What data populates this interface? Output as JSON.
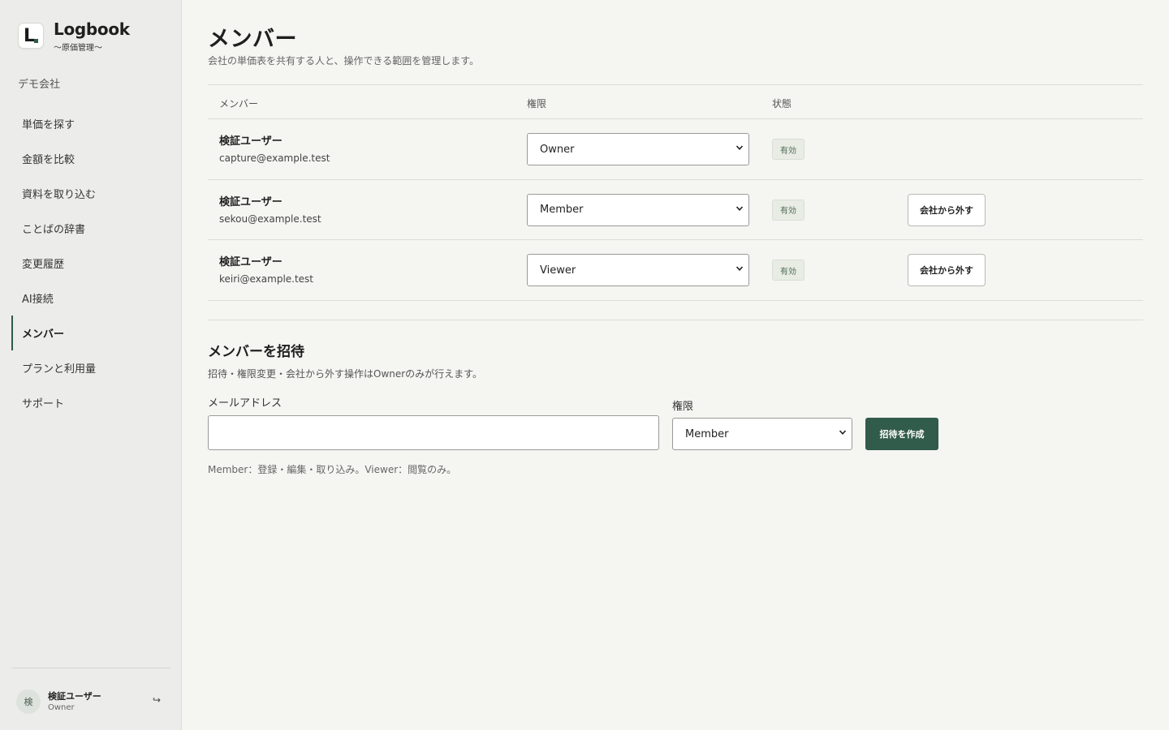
{
  "brand": {
    "name": "Logbook",
    "subtitle": "〜原価管理〜",
    "logo_letter": "L"
  },
  "company": "デモ会社",
  "nav": [
    {
      "label": "単価を探す",
      "active": false
    },
    {
      "label": "金額を比較",
      "active": false
    },
    {
      "label": "資料を取り込む",
      "active": false
    },
    {
      "label": "ことばの辞書",
      "active": false
    },
    {
      "label": "変更履歴",
      "active": false
    },
    {
      "label": "AI接続",
      "active": false
    },
    {
      "label": "メンバー",
      "active": true
    },
    {
      "label": "プランと利用量",
      "active": false
    },
    {
      "label": "サポート",
      "active": false
    }
  ],
  "user": {
    "avatar_letter": "検",
    "name": "検証ユーザー",
    "role": "Owner",
    "logout_icon": "↪"
  },
  "page": {
    "title": "メンバー",
    "description": "会社の単価表を共有する人と、操作できる範囲を管理します。"
  },
  "table": {
    "headers": {
      "member": "メンバー",
      "role": "権限",
      "status": "状態"
    },
    "rows": [
      {
        "name": "検証ユーザー",
        "email": "capture@example.test",
        "role": "Owner",
        "status": "有効",
        "remove_label": ""
      },
      {
        "name": "検証ユーザー",
        "email": "sekou@example.test",
        "role": "Member",
        "status": "有効",
        "remove_label": "会社から外す"
      },
      {
        "name": "検証ユーザー",
        "email": "keiri@example.test",
        "role": "Viewer",
        "status": "有効",
        "remove_label": "会社から外す"
      }
    ]
  },
  "invite": {
    "title": "メンバーを招待",
    "description": "招待・権限変更・会社から外す操作はOwnerのみが行えます。",
    "email_label": "メールアドレス",
    "email_value": "",
    "role_label": "権限",
    "role_value": "Member",
    "submit_label": "招待を作成",
    "note": "Member：登録・編集・取り込み。Viewer：閲覧のみ。"
  },
  "colors": {
    "accent": "#315b4b",
    "status_bg": "#e8ece4",
    "status_text": "#4d6a55"
  }
}
